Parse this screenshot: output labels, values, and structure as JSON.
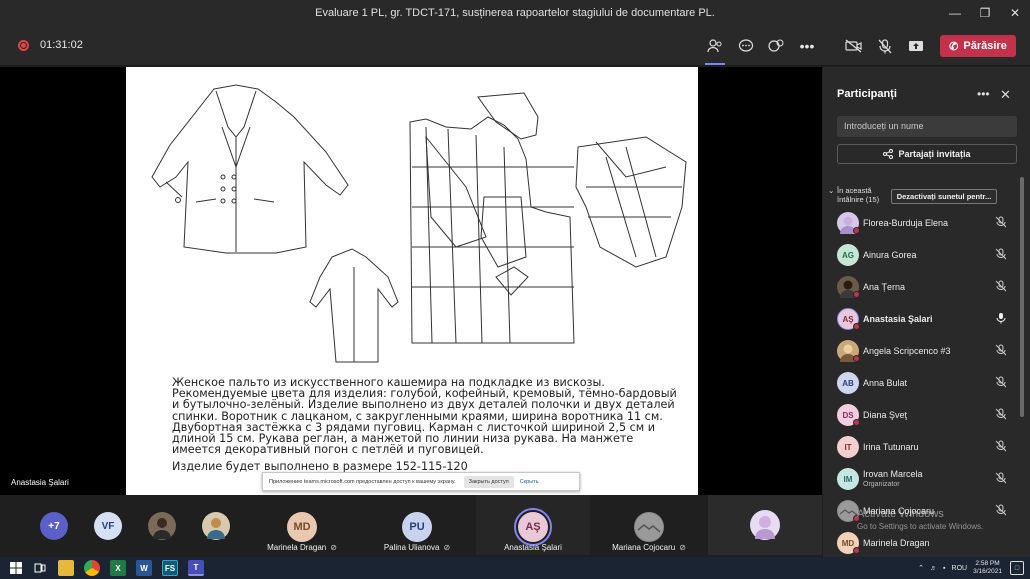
{
  "window": {
    "title": "Evaluare 1 PL, gr. TDCT-171, susținerea rapoartelor stagiului de documentare PL."
  },
  "call": {
    "timer": "01:31:02",
    "leave_label": "Părăsire"
  },
  "slide": {
    "paragraph": "Женское пальто из искусственного кашемира на подкладке из вискозы. Рекомендуемые цвета для изделия: голубой, кофейный, кремовый, тёмно-бардовый и бутылочно-зелёный. Изделие выполнено из двух деталей полочки и двух деталей спинки. Воротник с лацканом, с закругленными краями, ширина воротника 11 см. Двубортная застёжка с 3 рядами пуговиц. Карман с листочкой шириной 2,5 см и длиной 15 см. Рукава реглан, а манжетой по линии низа рукава. На манжете имеется декоративный погон с петлёй и пуговицей.",
    "size_line": "Изделие будет выполнено в размере 152-115-120"
  },
  "share_bar": {
    "message": "Приложению teams.microsoft.com предоставлен доступ к вашему экрану.",
    "stop_label": "Закрыть доступ",
    "hide_label": "Скрыть"
  },
  "presenter_label": "Anastasia Şalari",
  "roster": {
    "overflow": "+7",
    "small_avatars": [
      {
        "initials": "VF"
      }
    ],
    "tiles": [
      {
        "initials": "MD",
        "name": "Marinela Dragan",
        "color": "#e8c9b0",
        "fg": "#7a4a2a"
      },
      {
        "initials": "PU",
        "name": "Palina Ulianova",
        "color": "#c9d3ee",
        "fg": "#2b3f7a"
      },
      {
        "initials": "AŞ",
        "name": "Anastasia Şalari",
        "color": "#e9c9d8",
        "fg": "#7a2b4e"
      },
      {
        "initials": "",
        "name": "Mariana Cojocaru",
        "color": "#888888",
        "fg": "#333333"
      }
    ]
  },
  "panel": {
    "title": "Participanți",
    "search_placeholder": "Introduceți un nume",
    "invite_label": "Partajați invitația",
    "section_label": "În această întâlnire (15)",
    "mute_all_label": "Dezactivați sunetul pentr...",
    "participants": [
      {
        "initials": "",
        "name": "Florea-Burduja Elena",
        "avatar_color": "#d8c8e8",
        "fg": "#5a3a7a",
        "muted": true
      },
      {
        "initials": "AG",
        "name": "Ainura Gorea",
        "avatar_color": "#c6e6d6",
        "fg": "#2a6a4a",
        "muted": true
      },
      {
        "initials": "",
        "name": "Ana Țerna",
        "avatar_color": "#6a5a4a",
        "fg": "#ffffff",
        "muted": true
      },
      {
        "initials": "AŞ",
        "name": "Anastasia Şalari",
        "avatar_color": "#e9c9d8",
        "fg": "#7a2b4e",
        "muted": false,
        "bold": true
      },
      {
        "initials": "",
        "name": "Angela Scripcenco #3",
        "avatar_color": "#c9a87a",
        "fg": "#ffffff",
        "muted": true
      },
      {
        "initials": "AB",
        "name": "Anna Bulat",
        "avatar_color": "#cfd6ee",
        "fg": "#2b3f7a",
        "muted": true
      },
      {
        "initials": "DS",
        "name": "Diana Şveţ",
        "avatar_color": "#f0cfe0",
        "fg": "#8a2b5a",
        "muted": true
      },
      {
        "initials": "IT",
        "name": "Irina Tutunaru",
        "avatar_color": "#f3d0cf",
        "fg": "#8a2b2b",
        "muted": true
      },
      {
        "initials": "IM",
        "name": "Irovan Marcela",
        "role": "Organizator",
        "avatar_color": "#c6e6e2",
        "fg": "#2a6a64",
        "muted": true
      },
      {
        "initials": "",
        "name": "Mariana Cojocaru",
        "avatar_color": "#888888",
        "fg": "#ffffff",
        "muted": true
      },
      {
        "initials": "MD",
        "name": "Marinela Dragan",
        "avatar_color": "#f0d3b8",
        "fg": "#7a4a2a",
        "muted": true
      }
    ]
  },
  "watermark": {
    "line1": "Activate Windows",
    "line2": "Go to Settings to activate Windows."
  },
  "taskbar": {
    "lang": "ROU",
    "time": "2:58 PM",
    "date": "3/16/2021"
  }
}
